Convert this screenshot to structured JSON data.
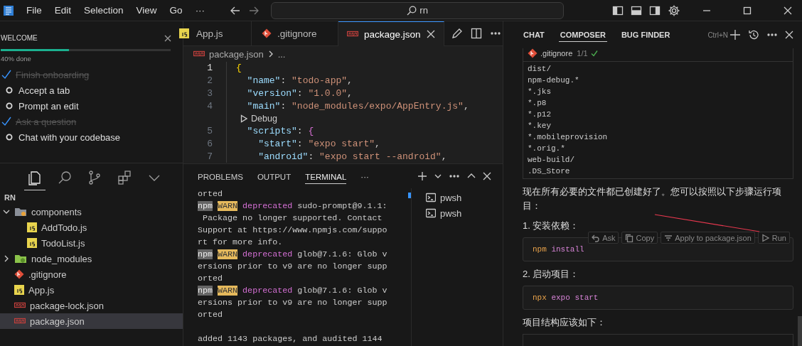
{
  "titlebar": {
    "menu": [
      "File",
      "Edit",
      "Selection",
      "View",
      "Go",
      "···"
    ],
    "search": {
      "value": "rn"
    }
  },
  "welcome": {
    "title": "WELCOME",
    "level": 0.4,
    "progress_text": "40% done",
    "items": [
      {
        "label": "Finish onboarding",
        "done": true
      },
      {
        "label": "Accept a tab",
        "done": false
      },
      {
        "label": "Prompt an edit",
        "done": false
      },
      {
        "label": "Ask a question",
        "done": true
      },
      {
        "label": "Chat with your codebase",
        "done": false
      }
    ]
  },
  "activity": [
    {
      "kind": "files",
      "selected": true
    },
    {
      "kind": "search",
      "selected": false
    },
    {
      "kind": "git",
      "selected": false
    },
    {
      "kind": "extensions",
      "selected": false
    },
    {
      "kind": "chevron",
      "selected": false
    }
  ],
  "explorer": {
    "title": "RN",
    "items": [
      {
        "label": "components",
        "kind": "folder",
        "expanded": true,
        "selected": false,
        "children": [
          {
            "label": "AddTodo.js",
            "kind": "js",
            "selected": false
          },
          {
            "label": "TodoList.js",
            "kind": "js",
            "selected": false
          }
        ]
      },
      {
        "label": "node_modules",
        "kind": "node",
        "expanded": false,
        "selected": false
      },
      {
        "label": ".gitignore",
        "kind": "git",
        "selected": false
      },
      {
        "label": "App.js",
        "kind": "js",
        "selected": false
      },
      {
        "label": "package-lock.json",
        "kind": "npm",
        "selected": false
      },
      {
        "label": "package.json",
        "kind": "npm",
        "selected": true
      }
    ]
  },
  "editor": {
    "tabs": [
      {
        "label": "App.js",
        "kind": "js",
        "selected": false
      },
      {
        "label": ".gitignore",
        "kind": "git",
        "selected": false
      },
      {
        "label": "package.json",
        "kind": "npm",
        "selected": true
      }
    ],
    "breadcrumb": [
      "package.json",
      "..."
    ],
    "lines": [
      {
        "kind": "code",
        "number": "1",
        "current": true,
        "tokens": [
          {
            "text": "{",
            "kind": "brace"
          }
        ]
      },
      {
        "kind": "code",
        "number": "2",
        "current": false,
        "tokens": [
          {
            "text": "  \"name\"",
            "kind": "key"
          },
          {
            "text": ": ",
            "kind": "plain"
          },
          {
            "text": "\"todo-app\"",
            "kind": "string"
          },
          {
            "text": ",",
            "kind": "plain"
          }
        ]
      },
      {
        "kind": "code",
        "number": "3",
        "current": false,
        "tokens": [
          {
            "text": "  \"version\"",
            "kind": "key"
          },
          {
            "text": ": ",
            "kind": "plain"
          },
          {
            "text": "\"1.0.0\"",
            "kind": "string"
          },
          {
            "text": ",",
            "kind": "plain"
          }
        ]
      },
      {
        "kind": "code",
        "number": "4",
        "current": false,
        "tokens": [
          {
            "text": "  \"main\"",
            "kind": "key"
          },
          {
            "text": ": ",
            "kind": "plain"
          },
          {
            "text": "\"node_modules/expo/AppEntry.js\"",
            "kind": "string"
          },
          {
            "text": ",",
            "kind": "plain"
          }
        ]
      },
      {
        "kind": "codelens",
        "label": "Debug"
      },
      {
        "kind": "code",
        "number": "5",
        "current": false,
        "tokens": [
          {
            "text": "  \"scripts\"",
            "kind": "key"
          },
          {
            "text": ": ",
            "kind": "plain"
          },
          {
            "text": "{",
            "kind": "brace2"
          }
        ]
      },
      {
        "kind": "code",
        "number": "6",
        "current": false,
        "tokens": [
          {
            "text": "    \"start\"",
            "kind": "key"
          },
          {
            "text": ": ",
            "kind": "plain"
          },
          {
            "text": "\"expo start\"",
            "kind": "string"
          },
          {
            "text": ",",
            "kind": "plain"
          }
        ]
      },
      {
        "kind": "code",
        "number": "7",
        "current": false,
        "tokens": [
          {
            "text": "    \"android\"",
            "kind": "key"
          },
          {
            "text": ": ",
            "kind": "plain"
          },
          {
            "text": "\"expo start --android\"",
            "kind": "string"
          },
          {
            "text": ",",
            "kind": "plain"
          }
        ]
      }
    ]
  },
  "panel": {
    "tabs": [
      {
        "label": "PROBLEMS",
        "selected": false
      },
      {
        "label": "OUTPUT",
        "selected": false
      },
      {
        "label": "TERMINAL",
        "selected": true
      },
      {
        "label": "···",
        "selected": false
      }
    ],
    "terminal_lines": [
      {
        "kind": "text",
        "segments": [
          {
            "text": "orted",
            "kind": "plain"
          }
        ]
      },
      {
        "kind": "text",
        "segments": [
          {
            "text": "npm",
            "kind": "badge"
          },
          {
            "text": "WARN",
            "kind": "warn"
          },
          {
            "text": "deprecated",
            "kind": "magenta"
          },
          {
            "text": "sudo-prompt@9.1.1:",
            "kind": "plain"
          }
        ]
      },
      {
        "kind": "text",
        "segments": [
          {
            "text": " Package no longer supported. Contact",
            "kind": "plain"
          }
        ]
      },
      {
        "kind": "text",
        "segments": [
          {
            "text": "Support at https://www.npmjs.com/suppo",
            "kind": "plain"
          }
        ]
      },
      {
        "kind": "text",
        "segments": [
          {
            "text": "rt for more info.",
            "kind": "plain"
          }
        ]
      },
      {
        "kind": "text",
        "segments": [
          {
            "text": "npm",
            "kind": "badge"
          },
          {
            "text": "WARN",
            "kind": "warn"
          },
          {
            "text": "deprecated",
            "kind": "magenta"
          },
          {
            "text": "glob@7.1.6: Glob v",
            "kind": "plain"
          }
        ]
      },
      {
        "kind": "text",
        "segments": [
          {
            "text": "ersions prior to v9 are no longer supp",
            "kind": "plain"
          }
        ]
      },
      {
        "kind": "text",
        "segments": [
          {
            "text": "orted",
            "kind": "plain"
          }
        ]
      },
      {
        "kind": "text",
        "segments": [
          {
            "text": "npm",
            "kind": "badge"
          },
          {
            "text": "WARN",
            "kind": "warn"
          },
          {
            "text": "deprecated",
            "kind": "magenta"
          },
          {
            "text": "glob@7.1.6: Glob v",
            "kind": "plain"
          }
        ]
      },
      {
        "kind": "text",
        "segments": [
          {
            "text": "ersions prior to v9 are no longer supp",
            "kind": "plain"
          }
        ]
      },
      {
        "kind": "text",
        "segments": [
          {
            "text": "orted",
            "kind": "plain"
          }
        ]
      },
      {
        "kind": "blank"
      },
      {
        "kind": "text",
        "segments": [
          {
            "text": "added 1143 packages, and audited 1144",
            "kind": "plain"
          }
        ]
      }
    ],
    "shells": [
      "pwsh",
      "pwsh"
    ]
  },
  "chat": {
    "tabs": [
      {
        "label": "CHAT",
        "selected": false
      },
      {
        "label": "COMPOSER",
        "selected": true
      },
      {
        "label": "BUG FINDER",
        "selected": false
      }
    ],
    "shortcut": "Ctrl+N",
    "file_block": {
      "name": ".gitignore",
      "count": "1/1",
      "lines": [
        "dist/",
        "npm-debug.*",
        "*.jks",
        "*.p8",
        "*.p12",
        "*.key",
        "*.mobileprovision",
        "*.orig.*",
        "web-build/",
        ".DS_Store"
      ]
    },
    "content": [
      {
        "kind": "paragraph",
        "text": "现在所有必要的文件都已创建好了。您可以按照以下步骤运行项目："
      },
      {
        "kind": "paragraph",
        "text": "1. 安装依赖："
      },
      {
        "kind": "code",
        "actions": [
          {
            "label": "Ask",
            "kind": "undo"
          },
          {
            "label": "Copy",
            "kind": "copy"
          },
          {
            "label": "Apply to package.json",
            "kind": "apply"
          },
          {
            "label": "Run",
            "kind": "run"
          }
        ],
        "tokens": [
          {
            "text": "npm",
            "kind": "cmd"
          },
          {
            "text": "install",
            "kind": "arg"
          }
        ]
      },
      {
        "kind": "paragraph",
        "text": "2. 启动项目："
      },
      {
        "kind": "code",
        "tokens": [
          {
            "text": "npx",
            "kind": "cmd"
          },
          {
            "text": "expo",
            "kind": "arg"
          },
          {
            "text": "start",
            "kind": "arg"
          }
        ]
      },
      {
        "kind": "paragraph",
        "text": "项目结构应该如下："
      },
      {
        "kind": "code_stub"
      }
    ]
  }
}
